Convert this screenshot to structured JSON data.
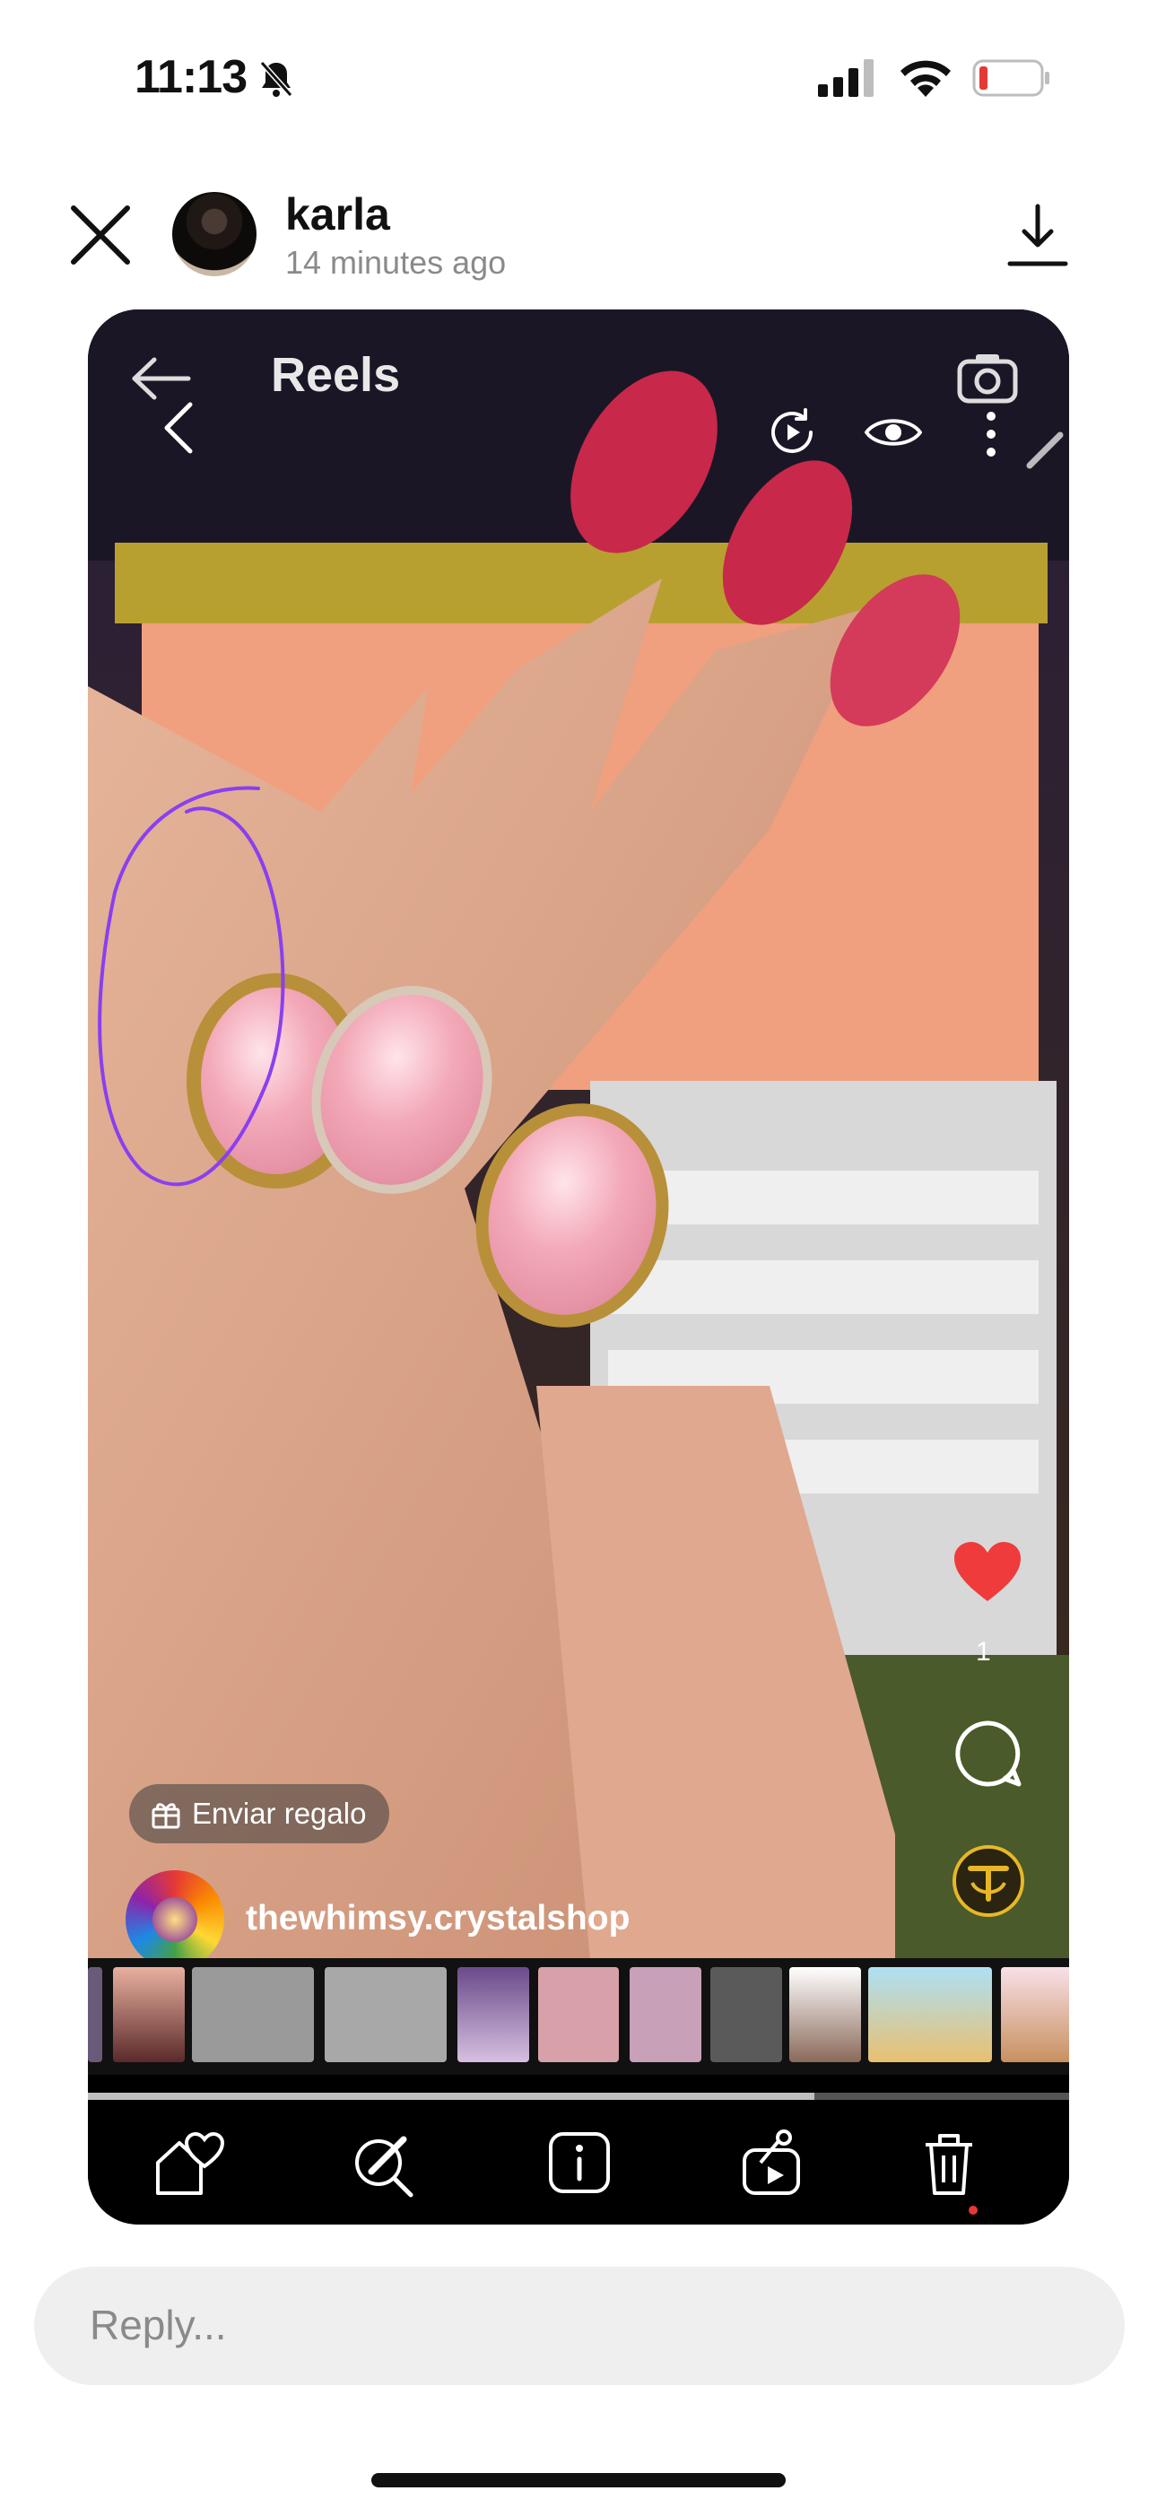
{
  "status_bar": {
    "time": "11:13",
    "icons": [
      "bell-slash-icon",
      "cellular-signal-icon",
      "wifi-icon",
      "battery-low-icon"
    ],
    "battery_color": "#e53935"
  },
  "header": {
    "username": "karla",
    "timestamp": "14 minutes ago",
    "icons": [
      "close-icon",
      "download-icon"
    ]
  },
  "reel": {
    "title": "Reels",
    "gift_label": "Enviar regalo",
    "handle": "thewhimsy.crystalshop",
    "like_count": "1",
    "like_color": "#ef3b3b",
    "annotation_color": "#8a3ff0",
    "playback_progress": 0.74,
    "icons": [
      "back-arrow-icon",
      "chevron-left-icon",
      "camera-icon",
      "replay-icon",
      "eye-icon",
      "more-vertical-icon",
      "pencil-icon",
      "heart-icon",
      "comment-icon",
      "creator-badge-icon",
      "gift-icon"
    ]
  },
  "toolbar": {
    "icons": [
      "home-heart-icon",
      "edit-search-icon",
      "info-icon",
      "share-icon",
      "trash-icon"
    ]
  },
  "reply": {
    "placeholder": "Reply..."
  }
}
